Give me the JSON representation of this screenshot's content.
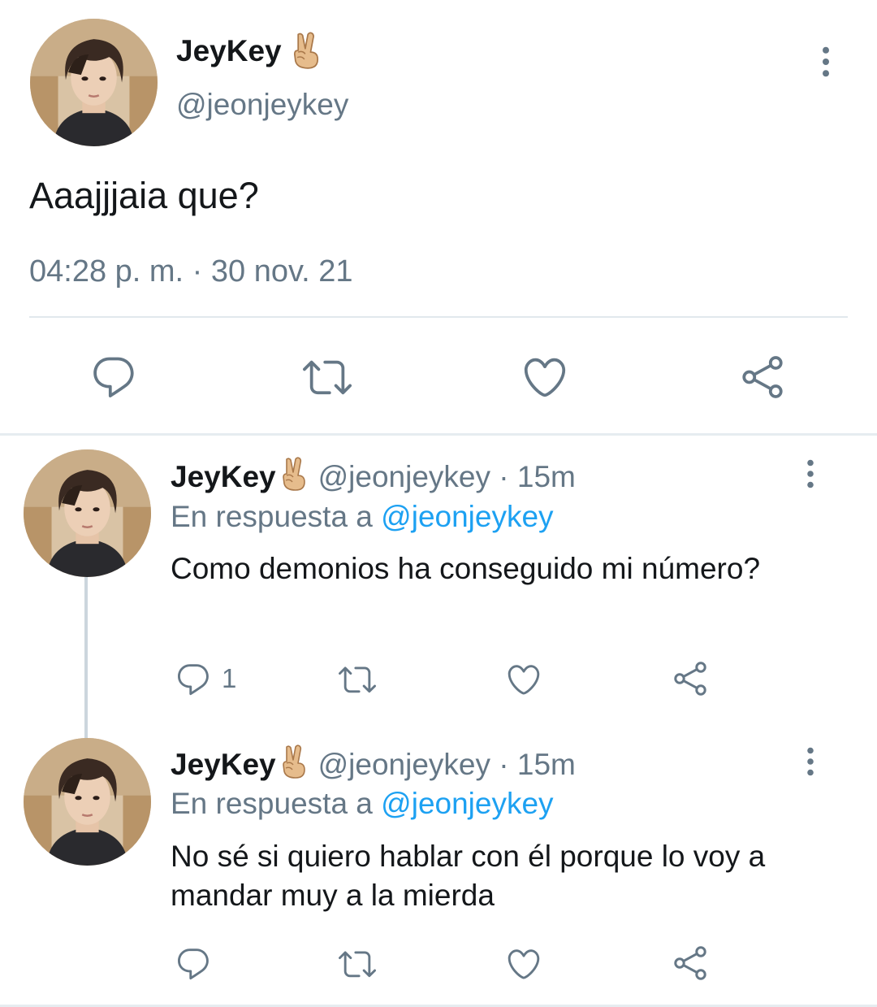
{
  "main_tweet": {
    "display_name": "JeyKey",
    "name_emoji": "victory-hand-emoji",
    "handle": "@jeonjeykey",
    "text": "Aaajjjaia que?",
    "timestamp": "04:28 p. m. · 30 nov. 21",
    "actions": [
      "reply-icon",
      "retweet-icon",
      "like-icon",
      "share-icon"
    ]
  },
  "replies": [
    {
      "display_name": "JeyKey",
      "handle": "@jeonjeykey",
      "separator": "·",
      "time": "15m",
      "reply_prefix": "En respuesta a",
      "reply_mention": "@jeonjeykey",
      "text": "Como demonios ha conseguido mi número?",
      "reply_count": "1"
    },
    {
      "display_name": "JeyKey",
      "handle": "@jeonjeykey",
      "separator": "·",
      "time": "15m",
      "reply_prefix": "En respuesta a",
      "reply_mention": "@jeonjeykey",
      "text": "No sé si quiero hablar con él porque lo voy a mandar muy a la mierda",
      "reply_count": ""
    }
  ],
  "colors": {
    "text_primary": "#14171a",
    "text_secondary": "#657786",
    "link": "#1da1f2",
    "divider": "#e1e8ed"
  }
}
